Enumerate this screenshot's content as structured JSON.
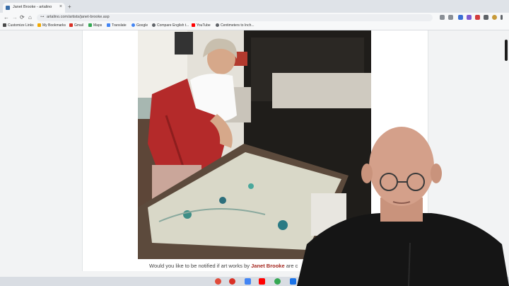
{
  "browser": {
    "tab_title": "Janet Brooke - artalino",
    "tab_close": "×",
    "new_tab": "+",
    "back": "←",
    "forward": "→",
    "reload": "⟳",
    "home": "⌂",
    "url": "artalino.com/artists/janet-brooke.asp"
  },
  "bookmarks": [
    {
      "label": "Customize Links",
      "color": "#4a4a4a"
    },
    {
      "label": "My Bookmarks",
      "color": "#f2a900"
    },
    {
      "label": "Gmail",
      "color": "#d93025"
    },
    {
      "label": "Maps",
      "color": "#34a853"
    },
    {
      "label": "Translate",
      "color": "#4285f4"
    },
    {
      "label": "Google",
      "color": "#4285f4"
    },
    {
      "label": "Compare English t...",
      "color": "#5f6368"
    },
    {
      "label": "YouTube",
      "color": "#ff0000"
    },
    {
      "label": "Centimeters to Inch...",
      "color": "#5f6368"
    }
  ],
  "page": {
    "notify_prefix": "Would you like to be notified if art works by",
    "artist_name": "Janet Brooke",
    "notify_suffix": "are c"
  },
  "colors": {
    "accent": "#a4271f",
    "taskbar": "#d9dde3"
  }
}
